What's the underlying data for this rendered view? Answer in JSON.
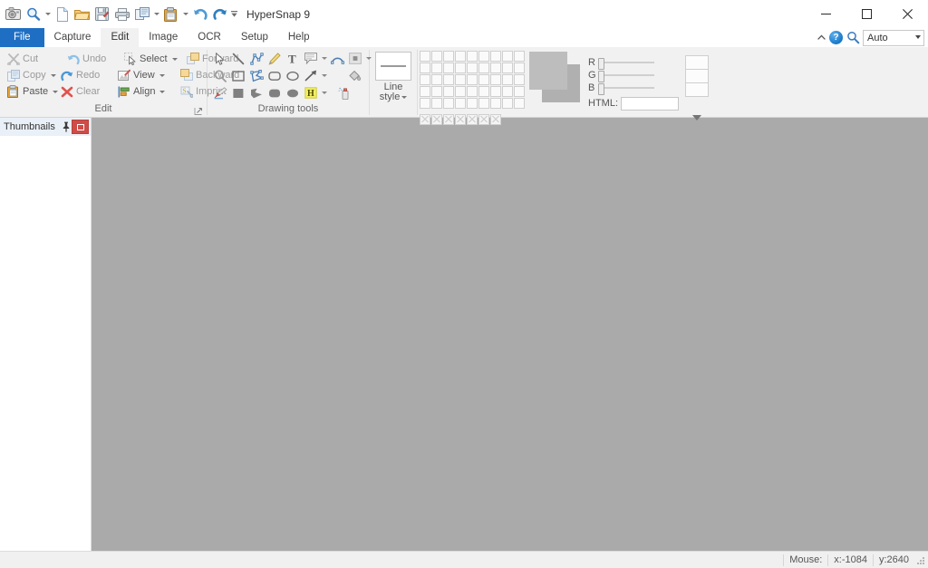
{
  "window": {
    "title": "HyperSnap 9",
    "controls": {
      "minimize": "–",
      "maximize": "☐",
      "close": "✕"
    }
  },
  "quick_access": {
    "items": [
      {
        "name": "capture-screen-icon",
        "tooltip": "Capture"
      },
      {
        "name": "zoom-icon",
        "tooltip": "Zoom"
      },
      {
        "name": "new-document-icon",
        "tooltip": "New"
      },
      {
        "name": "open-folder-icon",
        "tooltip": "Open"
      },
      {
        "name": "save-icon",
        "tooltip": "Save"
      },
      {
        "name": "print-icon",
        "tooltip": "Print"
      },
      {
        "name": "copy-icon",
        "tooltip": "Copy"
      },
      {
        "name": "paste-icon",
        "tooltip": "Paste"
      },
      {
        "name": "undo-icon",
        "tooltip": "Undo"
      },
      {
        "name": "redo-icon",
        "tooltip": "Redo"
      }
    ]
  },
  "tabs": [
    {
      "label": "File",
      "state": "file"
    },
    {
      "label": "Capture",
      "state": "normal"
    },
    {
      "label": "Edit",
      "state": "active"
    },
    {
      "label": "Image",
      "state": "normal"
    },
    {
      "label": "OCR",
      "state": "normal"
    },
    {
      "label": "Setup",
      "state": "normal"
    },
    {
      "label": "Help",
      "state": "normal"
    }
  ],
  "tabs_right": {
    "collapse_icon": "▲",
    "help_glyph": "?",
    "search_icon": "search-icon",
    "search_value": "Auto"
  },
  "ribbon": {
    "edit_group": {
      "label": "Edit",
      "rows": [
        [
          {
            "label": "Cut",
            "icon": "scissors-icon",
            "dim": true,
            "caret": false
          },
          {
            "label": "Undo",
            "icon": "undo-arrow-icon",
            "dim": true,
            "caret": false
          },
          {
            "label": "Select",
            "icon": "select-cursor-icon",
            "dim": false,
            "caret": true
          },
          {
            "label": "Forward",
            "icon": "bring-forward-icon",
            "dim": true,
            "caret": false
          }
        ],
        [
          {
            "label": "Copy",
            "icon": "copy-icon",
            "dim": true,
            "caret": true
          },
          {
            "label": "Redo",
            "icon": "redo-arrow-icon",
            "dim": true,
            "caret": false
          },
          {
            "label": "View",
            "icon": "view-icon",
            "dim": false,
            "caret": true
          },
          {
            "label": "Backward",
            "icon": "send-backward-icon",
            "dim": true,
            "caret": false
          }
        ],
        [
          {
            "label": "Paste",
            "icon": "paste-icon",
            "dim": false,
            "caret": true
          },
          {
            "label": "Clear",
            "icon": "clear-x-icon",
            "dim": true,
            "caret": false
          },
          {
            "label": "Align",
            "icon": "align-icon",
            "dim": false,
            "caret": true
          },
          {
            "label": "Imprint",
            "icon": "imprint-icon",
            "dim": true,
            "caret": false
          }
        ]
      ]
    },
    "drawing_group": {
      "label": "Drawing tools",
      "rows": [
        [
          {
            "icon": "pointer-arrow-icon",
            "caret": false
          },
          {
            "icon": "line-tool-icon",
            "caret": false
          },
          {
            "icon": "polyline-tool-icon",
            "caret": false
          },
          {
            "icon": "pencil-tool-icon",
            "caret": false
          },
          {
            "icon": "text-tool-icon",
            "caret": false
          },
          {
            "icon": "callout-tool-icon",
            "caret": true
          },
          {
            "icon": "arc-tool-icon",
            "caret": false
          },
          {
            "icon": "shape-tool-icon",
            "caret": true
          }
        ],
        [
          {
            "icon": "magnifier-tool-icon",
            "caret": false
          },
          {
            "icon": "rectangle-tool-icon",
            "caret": false
          },
          {
            "icon": "polygon-tool-icon",
            "caret": false
          },
          {
            "icon": "rounded-rectangle-tool-icon",
            "caret": false
          },
          {
            "icon": "ellipse-tool-icon",
            "caret": false
          },
          {
            "icon": "arrow-tool-icon",
            "caret": true
          },
          {
            "icon": "fill-bucket-tool-icon",
            "caret": false
          }
        ],
        [
          {
            "icon": "brush-tool-icon",
            "caret": false
          },
          {
            "icon": "filled-rectangle-tool-icon",
            "caret": false
          },
          {
            "icon": "filled-polygon-tool-icon",
            "caret": false
          },
          {
            "icon": "filled-rounded-rectangle-tool-icon",
            "caret": false
          },
          {
            "icon": "filled-ellipse-tool-icon",
            "caret": false
          },
          {
            "icon": "highlighter-tool-icon",
            "caret": true
          },
          {
            "icon": "spray-tool-icon",
            "caret": false
          }
        ]
      ]
    },
    "line_style": {
      "label_line1": "Line",
      "label_line2": "style"
    },
    "colors": {
      "palette_rows": 5,
      "palette_cols": 9,
      "transparent_row_count": 7,
      "foreground_color": "#bdbdbd",
      "background_color": "#b0b0b0",
      "channels": [
        {
          "label": "R",
          "value": 0
        },
        {
          "label": "G",
          "value": 0
        },
        {
          "label": "B",
          "value": 0
        }
      ],
      "html_label": "HTML:",
      "html_value": ""
    }
  },
  "thumbnails_panel": {
    "title": "Thumbnails",
    "pin_icon": "pin-icon",
    "close_icon": "close-icon"
  },
  "status_bar": {
    "mouse_label": "Mouse:",
    "x_value": "x:-1084",
    "y_value": "y:2640"
  }
}
